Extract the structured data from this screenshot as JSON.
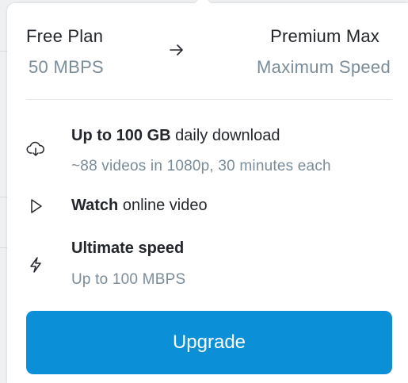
{
  "plans": {
    "current": {
      "name": "Free Plan",
      "subtitle": "50 MBPS"
    },
    "target": {
      "name": "Premium Max",
      "subtitle": "Maximum Speed"
    },
    "arrow_icon": "arrow-right-icon"
  },
  "features": [
    {
      "icon": "cloud-download-icon",
      "title_bold": "Up to 100 GB",
      "title_rest": " daily download",
      "subtitle": "~88 videos in 1080p, 30 minutes each"
    },
    {
      "icon": "play-icon",
      "title_bold": "Watch",
      "title_rest": " online video",
      "subtitle": ""
    },
    {
      "icon": "lightning-icon",
      "title_bold": "Ultimate speed",
      "title_rest": "",
      "subtitle": "Up to 100 MBPS"
    }
  ],
  "upgrade_button": {
    "label": "Upgrade",
    "color": "#0b8fd6"
  },
  "colors": {
    "text_primary": "#23272c",
    "text_secondary": "#7b8c99",
    "accent": "#0b8fd6"
  }
}
